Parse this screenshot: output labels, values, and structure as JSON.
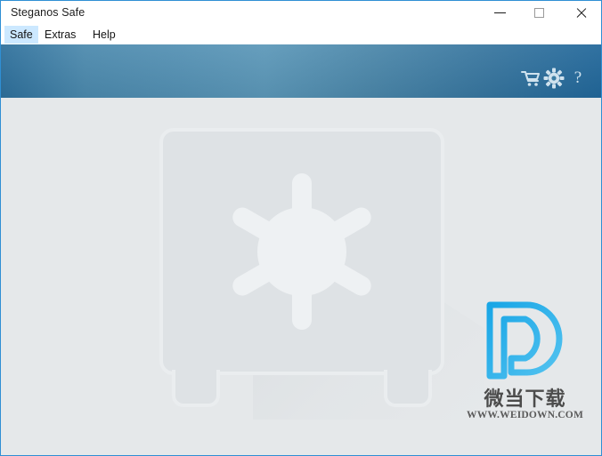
{
  "window": {
    "title": "Steganos Safe",
    "border_color": "#2f8fd4",
    "controls": {
      "minimize": "—",
      "maximize": "☐",
      "close": "✕"
    }
  },
  "menubar": {
    "items": [
      {
        "label": "Safe",
        "selected": true
      },
      {
        "label": "Extras",
        "selected": false
      },
      {
        "label": "Help",
        "selected": false
      }
    ],
    "selected_background": "#cce8ff"
  },
  "header": {
    "background_gradient_from": "#2d6f9b",
    "background_gradient_mid": "#5b97b8",
    "background_gradient_to": "#21679a",
    "icons": [
      {
        "name": "cart-icon",
        "tooltip": "Shop"
      },
      {
        "name": "gear-icon",
        "tooltip": "Settings"
      },
      {
        "name": "help-icon",
        "label": "?"
      }
    ]
  },
  "wizard": {
    "accent_color": "#3ccb62",
    "badge_color": "#ffc107",
    "steps": [
      {
        "name": "current-safe",
        "state": "active",
        "badge": "lightning"
      },
      {
        "name": "add-safe",
        "state": "action",
        "label": "+"
      },
      {
        "name": "new-safe-placeholder",
        "state": "placeholder"
      }
    ]
  },
  "main": {
    "background": "#e5e8ea",
    "illustration": {
      "name": "safe-illustration",
      "body_color": "#dee2e5",
      "outline_color": "#eaedef",
      "dial_color": "#eef1f3",
      "spokes": 6
    }
  },
  "watermark": {
    "logo_name": "weidown-d-logo",
    "logo_color_from": "#1fa9e8",
    "logo_color_to": "#3fbbee",
    "chinese_text": "微当下载",
    "url_text": "WWW.WEIDOWN.COM"
  }
}
